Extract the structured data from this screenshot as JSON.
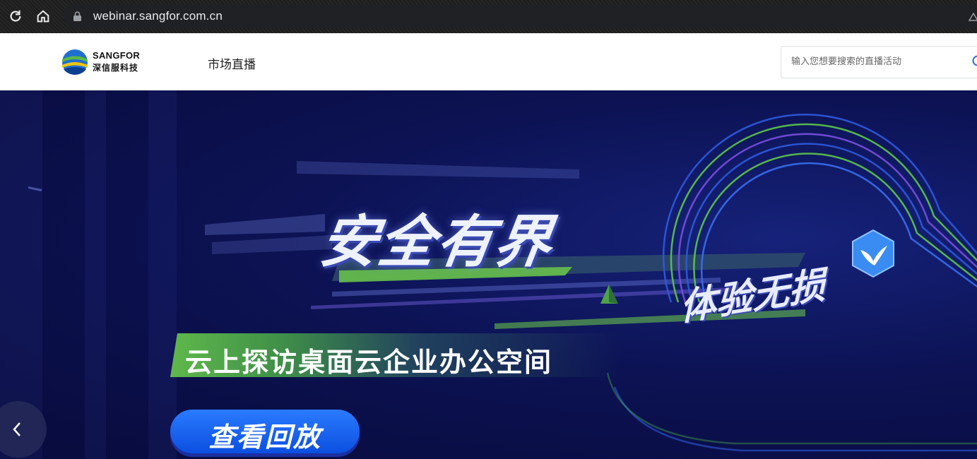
{
  "browser": {
    "url": "webinar.sangfor.com.cn",
    "icons": [
      "reload-icon",
      "home-icon",
      "lock-icon",
      "extension-icon"
    ]
  },
  "header": {
    "logo_en": "SANGFOR",
    "logo_cn": "深信服科技",
    "nav_items": [
      "市场直播"
    ],
    "search_placeholder": "输入您想要搜索的直播活动"
  },
  "banner": {
    "headline": "安全有界",
    "subheadline": "体验无损",
    "tagline": "云上探访桌面云企业办公空间",
    "cta_label": "查看回放",
    "accent_green": "#5fb84a",
    "accent_blue": "#0c4fe0",
    "background": "#0c1253"
  }
}
